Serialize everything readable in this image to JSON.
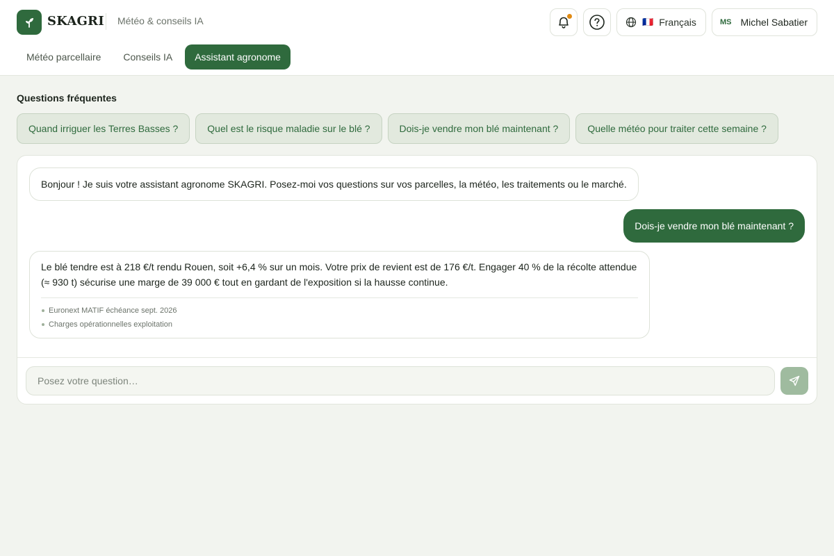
{
  "header": {
    "brand": "SKAGRI",
    "subtitle": "Météo & conseils IA",
    "language": {
      "flag": "🇫🇷",
      "label": "Français"
    },
    "user": {
      "initials": "MS",
      "name": "Michel Sabatier"
    },
    "accent_color": "#2f6a3d",
    "notification_dot_color": "#e08a12"
  },
  "tabs": [
    {
      "label": "Météo parcellaire",
      "active": false
    },
    {
      "label": "Conseils IA",
      "active": false
    },
    {
      "label": "Assistant agronome",
      "active": true
    }
  ],
  "faq": {
    "title": "Questions fréquentes",
    "items": [
      "Quand irriguer les Terres Basses ?",
      "Quel est le risque maladie sur le blé ?",
      "Dois-je vendre mon blé maintenant ?",
      "Quelle météo pour traiter cette semaine ?"
    ]
  },
  "chat": {
    "messages": [
      {
        "role": "assistant",
        "text": "Bonjour ! Je suis votre assistant agronome SKAGRI. Posez-moi vos questions sur vos parcelles, la météo, les traitements ou le marché."
      },
      {
        "role": "user",
        "text": "Dois-je vendre mon blé maintenant ?"
      },
      {
        "role": "assistant",
        "text": "Le blé tendre est à 218 €/t rendu Rouen, soit +6,4 % sur un mois. Votre prix de revient est de 176 €/t. Engager 40 % de la récolte attendue (≈ 930 t) sécurise une marge de 39 000 € tout en gardant de l'exposition si la hausse continue.",
        "sources": [
          "Euronext MATIF échéance sept. 2026",
          "Charges opérationnelles exploitation"
        ]
      }
    ],
    "input_placeholder": "Posez votre question…",
    "input_value": ""
  }
}
